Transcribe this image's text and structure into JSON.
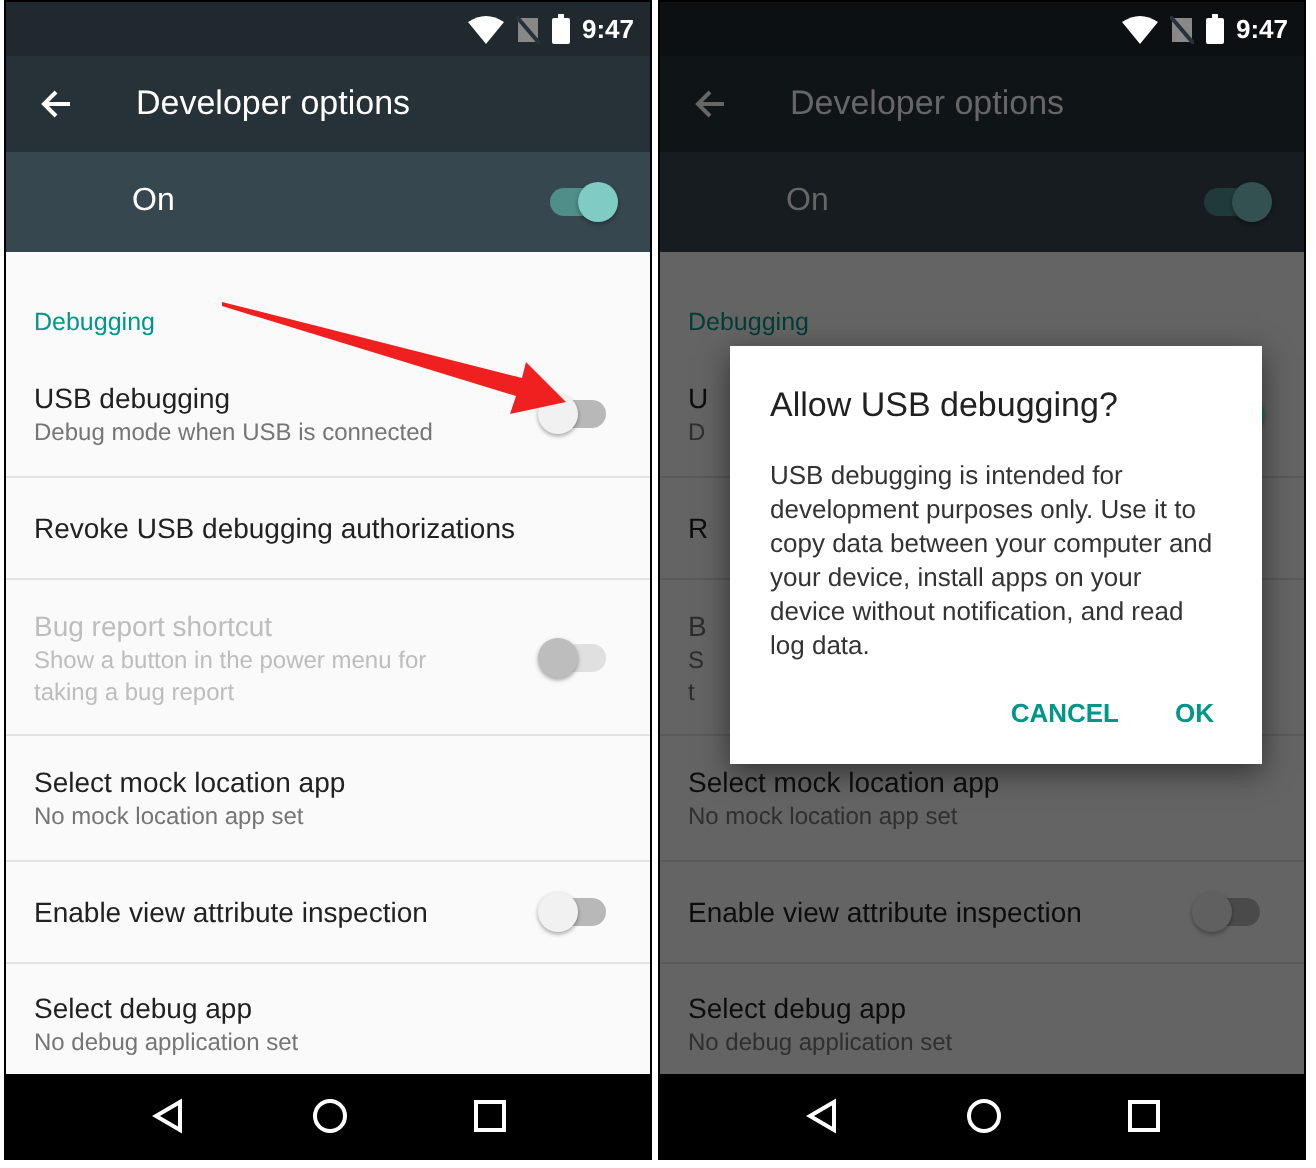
{
  "screens": [
    {
      "dimmed": false,
      "annotated": true,
      "status_bar": {
        "time": "9:47"
      },
      "toolbar": {
        "title": "Developer options"
      },
      "master_switch": {
        "label": "On",
        "on": true
      },
      "section_header": "Debugging",
      "items": [
        {
          "kind": "switch",
          "title": "USB debugging",
          "subtitle_lines": [
            "Debug mode when USB is connected"
          ],
          "on": false,
          "disabled": false
        },
        {
          "kind": "text",
          "title": "Revoke USB debugging authorizations",
          "disabled": false
        },
        {
          "kind": "switch",
          "title": "Bug report shortcut",
          "subtitle_lines": [
            "Show a button in the power menu for",
            "taking a bug report"
          ],
          "on": false,
          "disabled": true
        },
        {
          "kind": "text",
          "title": "Select mock location app",
          "subtitle_lines": [
            "No mock location app set"
          ],
          "disabled": false
        },
        {
          "kind": "switch",
          "title": "Enable view attribute inspection",
          "on": false,
          "disabled": false
        },
        {
          "kind": "text",
          "title": "Select debug app",
          "subtitle_lines": [
            "No debug application set"
          ],
          "disabled": false
        }
      ]
    },
    {
      "dimmed": true,
      "annotated": false,
      "status_bar": {
        "time": "9:47"
      },
      "toolbar": {
        "title": "Developer options"
      },
      "master_switch": {
        "label": "On",
        "on": true
      },
      "section_header": "Debugging",
      "items": [
        {
          "kind": "switch",
          "title": "U",
          "subtitle_lines": [
            "D"
          ],
          "on": true,
          "disabled": false
        },
        {
          "kind": "text",
          "title": "R",
          "disabled": false
        },
        {
          "kind": "text",
          "title": "B",
          "subtitle_lines": [
            "S",
            "t"
          ],
          "disabled": true
        },
        {
          "kind": "text",
          "title": "Select mock location app",
          "subtitle_lines": [
            "No mock location app set"
          ],
          "disabled": false
        },
        {
          "kind": "switch",
          "title": "Enable view attribute inspection",
          "on": false,
          "disabled": false
        },
        {
          "kind": "text",
          "title": "Select debug app",
          "subtitle_lines": [
            "No debug application set"
          ],
          "disabled": false
        }
      ],
      "dialog": {
        "title": "Allow USB debugging?",
        "message": "USB debugging is intended for development purposes only. Use it to copy data between your computer and your device, install apps on your device without notification, and read log data.",
        "buttons": [
          "CANCEL",
          "OK"
        ]
      }
    }
  ]
}
